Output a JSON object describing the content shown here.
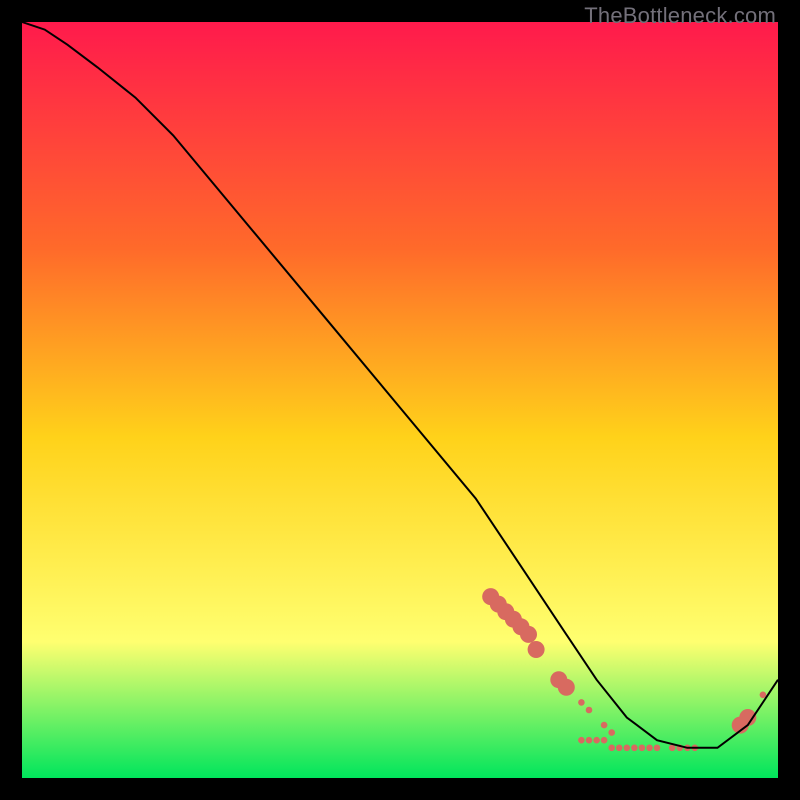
{
  "watermark": "TheBottleneck.com",
  "chart_data": {
    "type": "line",
    "title": "",
    "xlabel": "",
    "ylabel": "",
    "xlim": [
      0,
      100
    ],
    "ylim": [
      0,
      100
    ],
    "grid": false,
    "background_gradient": {
      "top": "#ff1a4c",
      "upper": "#ff6a2a",
      "mid": "#ffd21a",
      "lower": "#ffff70",
      "bottom": "#00e55c"
    },
    "series": [
      {
        "name": "bottleneck-curve",
        "color": "#000000",
        "x": [
          0,
          3,
          6,
          10,
          15,
          20,
          30,
          40,
          50,
          60,
          66,
          72,
          76,
          80,
          84,
          88,
          92,
          96,
          100
        ],
        "values": [
          100,
          99,
          97,
          94,
          90,
          85,
          73,
          61,
          49,
          37,
          28,
          19,
          13,
          8,
          5,
          4,
          4,
          7,
          13
        ]
      }
    ],
    "markers": {
      "name": "highlight-dots",
      "color": "#d86a60",
      "radius_small": 3.3,
      "radius_large": 8.5,
      "points": [
        {
          "x": 62,
          "y": 24,
          "r": "large"
        },
        {
          "x": 63,
          "y": 23,
          "r": "large"
        },
        {
          "x": 64,
          "y": 22,
          "r": "large"
        },
        {
          "x": 65,
          "y": 21,
          "r": "large"
        },
        {
          "x": 66,
          "y": 20,
          "r": "large"
        },
        {
          "x": 67,
          "y": 19,
          "r": "large"
        },
        {
          "x": 68,
          "y": 17,
          "r": "large"
        },
        {
          "x": 71,
          "y": 13,
          "r": "large"
        },
        {
          "x": 72,
          "y": 12,
          "r": "large"
        },
        {
          "x": 74,
          "y": 10,
          "r": "small"
        },
        {
          "x": 75,
          "y": 9,
          "r": "small"
        },
        {
          "x": 77,
          "y": 7,
          "r": "small"
        },
        {
          "x": 78,
          "y": 6,
          "r": "small"
        },
        {
          "x": 74,
          "y": 5,
          "r": "small"
        },
        {
          "x": 75,
          "y": 5,
          "r": "small"
        },
        {
          "x": 76,
          "y": 5,
          "r": "small"
        },
        {
          "x": 77,
          "y": 5,
          "r": "small"
        },
        {
          "x": 78,
          "y": 4,
          "r": "small"
        },
        {
          "x": 79,
          "y": 4,
          "r": "small"
        },
        {
          "x": 80,
          "y": 4,
          "r": "small"
        },
        {
          "x": 81,
          "y": 4,
          "r": "small"
        },
        {
          "x": 82,
          "y": 4,
          "r": "small"
        },
        {
          "x": 83,
          "y": 4,
          "r": "small"
        },
        {
          "x": 84,
          "y": 4,
          "r": "small"
        },
        {
          "x": 86,
          "y": 4,
          "r": "small"
        },
        {
          "x": 87,
          "y": 4,
          "r": "small"
        },
        {
          "x": 88,
          "y": 4,
          "r": "small"
        },
        {
          "x": 89,
          "y": 4,
          "r": "small"
        },
        {
          "x": 95,
          "y": 7,
          "r": "large"
        },
        {
          "x": 96,
          "y": 8,
          "r": "large"
        },
        {
          "x": 98,
          "y": 11,
          "r": "small"
        }
      ]
    }
  }
}
